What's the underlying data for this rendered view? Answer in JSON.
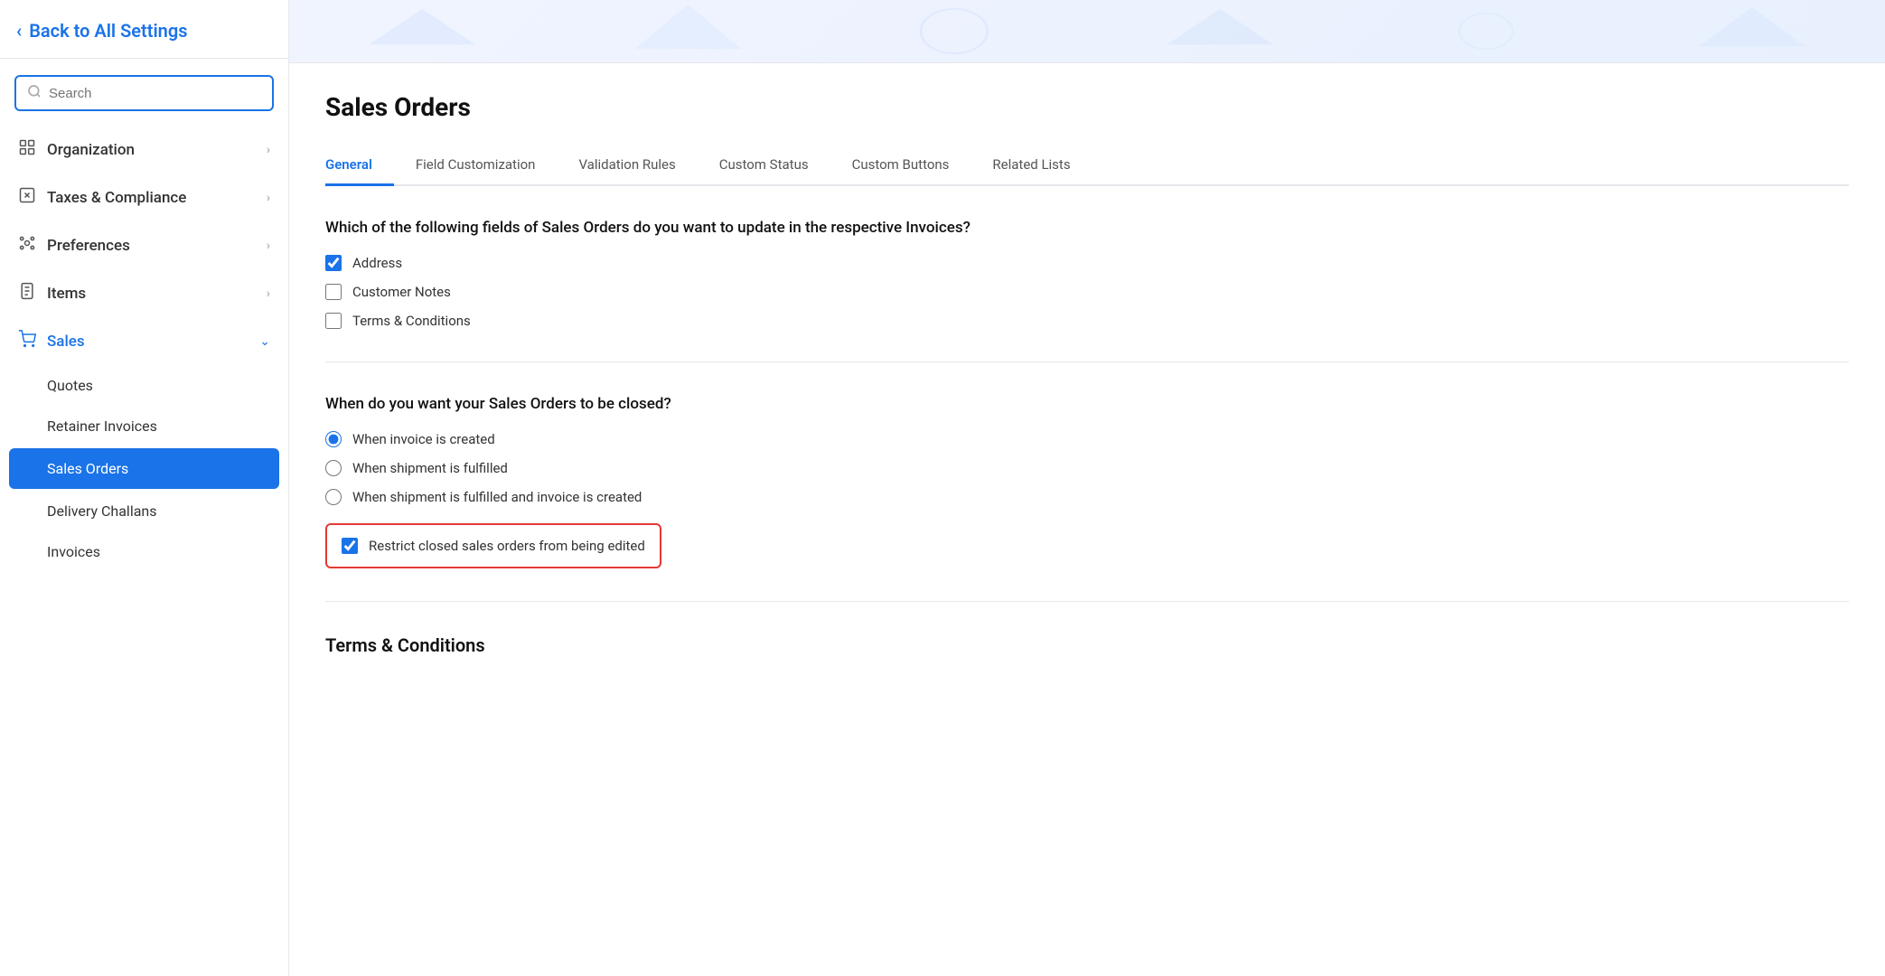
{
  "back_link": "Back to All Settings",
  "search": {
    "placeholder": "Search"
  },
  "nav": {
    "items": [
      {
        "id": "organization",
        "label": "Organization",
        "icon": "org",
        "expandable": true
      },
      {
        "id": "taxes-compliance",
        "label": "Taxes & Compliance",
        "icon": "taxes",
        "expandable": true
      },
      {
        "id": "preferences",
        "label": "Preferences",
        "icon": "prefs",
        "expandable": true
      },
      {
        "id": "items",
        "label": "Items",
        "icon": "items",
        "expandable": true
      },
      {
        "id": "sales",
        "label": "Sales",
        "icon": "sales",
        "expandable": true,
        "active": true
      }
    ],
    "sub_items": [
      {
        "id": "quotes",
        "label": "Quotes"
      },
      {
        "id": "retainer-invoices",
        "label": "Retainer Invoices"
      },
      {
        "id": "sales-orders",
        "label": "Sales Orders",
        "active": true
      },
      {
        "id": "delivery-challans",
        "label": "Delivery Challans"
      },
      {
        "id": "invoices",
        "label": "Invoices"
      }
    ]
  },
  "page": {
    "title": "Sales Orders",
    "tabs": [
      {
        "id": "general",
        "label": "General",
        "active": true
      },
      {
        "id": "field-customization",
        "label": "Field Customization"
      },
      {
        "id": "validation-rules",
        "label": "Validation Rules"
      },
      {
        "id": "custom-status",
        "label": "Custom Status"
      },
      {
        "id": "custom-buttons",
        "label": "Custom Buttons"
      },
      {
        "id": "related-lists",
        "label": "Related Lists"
      }
    ]
  },
  "sections": {
    "invoices_update": {
      "question": "Which of the following fields of Sales Orders do you want to update in the respective Invoices?",
      "checkboxes": [
        {
          "id": "address",
          "label": "Address",
          "checked": true
        },
        {
          "id": "customer-notes",
          "label": "Customer Notes",
          "checked": false
        },
        {
          "id": "terms-conditions",
          "label": "Terms & Conditions",
          "checked": false
        }
      ]
    },
    "closed_orders": {
      "question": "When do you want your Sales Orders to be closed?",
      "radio_options": [
        {
          "id": "invoice-created",
          "label": "When invoice is created",
          "checked": true
        },
        {
          "id": "shipment-fulfilled",
          "label": "When shipment is fulfilled",
          "checked": false
        },
        {
          "id": "shipment-and-invoice",
          "label": "When shipment is fulfilled and invoice is created",
          "checked": false
        }
      ],
      "restrict_checkbox": {
        "id": "restrict-closed",
        "label": "Restrict closed sales orders from being edited",
        "checked": true
      }
    },
    "terms": {
      "title": "Terms & Conditions"
    }
  }
}
